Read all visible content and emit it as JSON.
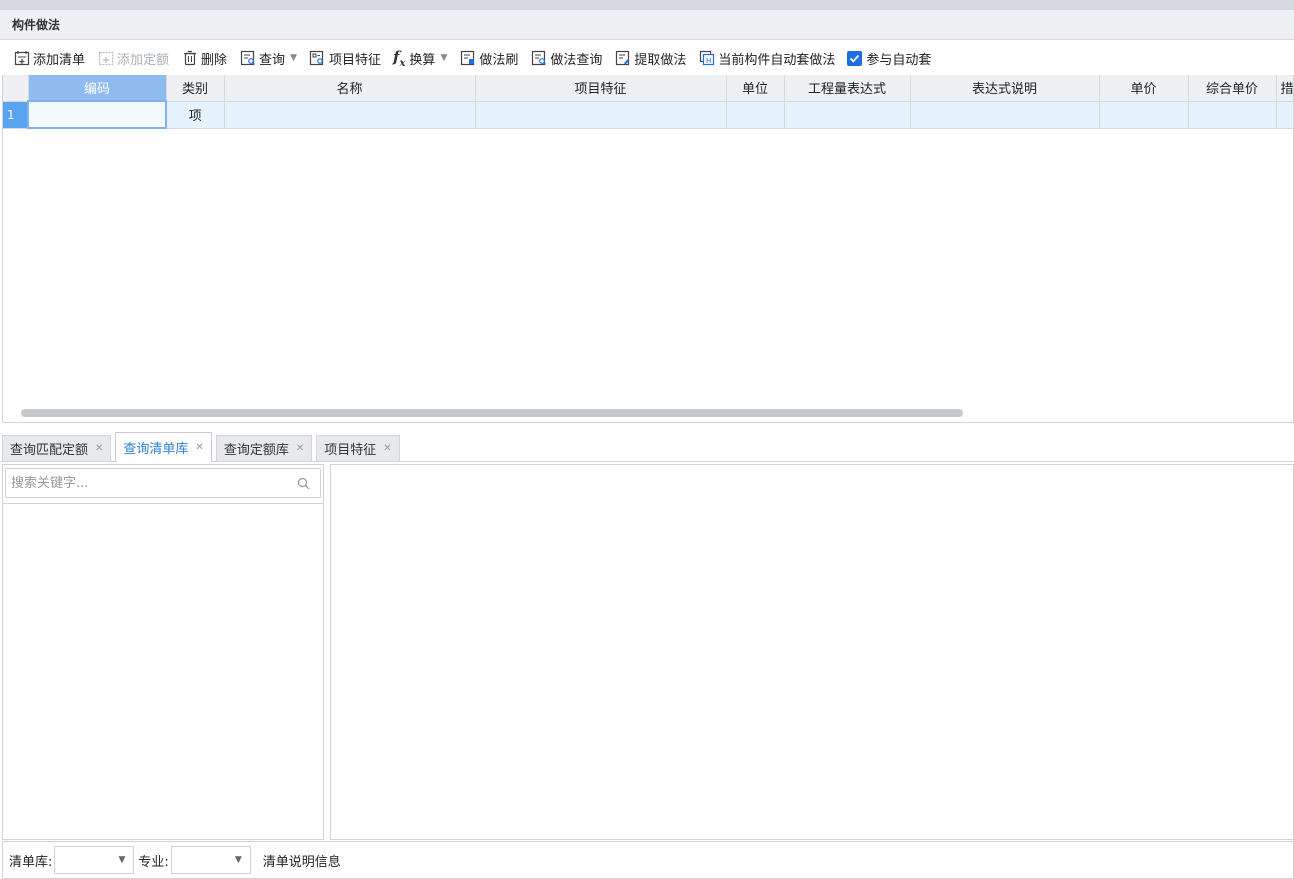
{
  "panel": {
    "title": "构件做法"
  },
  "toolbar": {
    "add_list": "添加清单",
    "add_quota": "添加定额",
    "delete": "删除",
    "query": "查询",
    "item_feature": "项目特征",
    "convert": "换算",
    "method_brush": "做法刷",
    "method_query": "做法查询",
    "extract_method": "提取做法",
    "auto_apply_current": "当前构件自动套做法",
    "participate_auto": "参与自动套"
  },
  "grid": {
    "columns": [
      "编码",
      "类别",
      "名称",
      "项目特征",
      "单位",
      "工程量表达式",
      "表达式说明",
      "单价",
      "综合单价",
      "措"
    ],
    "rows": [
      {
        "num": "1",
        "code": "",
        "category": "项",
        "name": "",
        "feature": "",
        "unit": "",
        "expr": "",
        "expr_desc": "",
        "price": "",
        "total_price": ""
      }
    ]
  },
  "tabs": [
    {
      "label": "查询匹配定额"
    },
    {
      "label": "查询清单库"
    },
    {
      "label": "查询定额库"
    },
    {
      "label": "项目特征"
    }
  ],
  "search": {
    "placeholder": "搜索关键字..."
  },
  "status": {
    "library_label": "清单库:",
    "major_label": "专业:",
    "info": "清单说明信息"
  },
  "colors": {
    "accent": "#2f7fd8",
    "header_active": "#8ebcf0",
    "row_bg": "#e6f2fc",
    "checkbox": "#1f6fe0"
  }
}
